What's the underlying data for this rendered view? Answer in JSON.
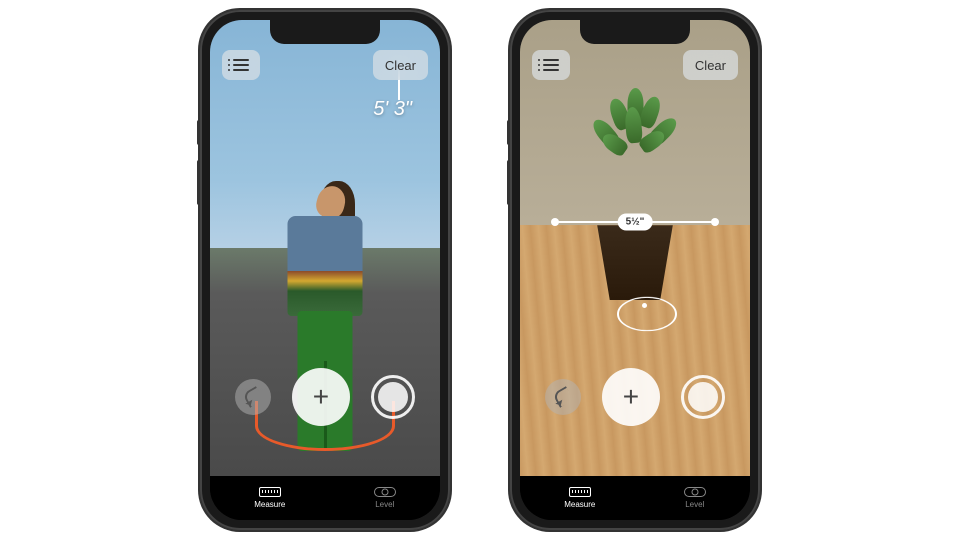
{
  "phone1": {
    "list_btn_name": "list",
    "clear_label": "Clear",
    "measurement": "5' 3\"",
    "add_label": "+",
    "tabs": {
      "measure": "Measure",
      "level": "Level"
    }
  },
  "phone2": {
    "list_btn_name": "list",
    "clear_label": "Clear",
    "measurement": "5½\"",
    "add_label": "+",
    "tabs": {
      "measure": "Measure",
      "level": "Level"
    }
  }
}
